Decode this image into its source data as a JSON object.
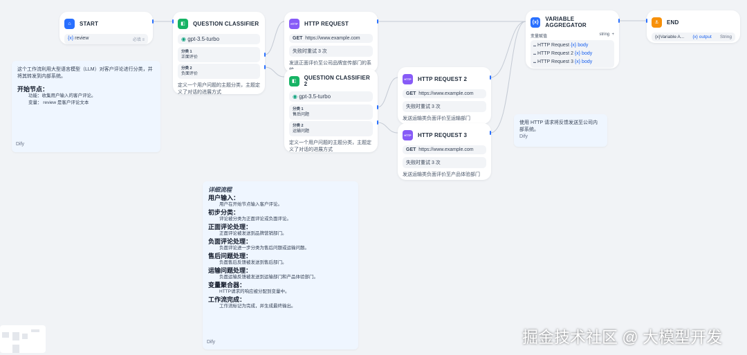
{
  "start": {
    "title": "START",
    "var": "review",
    "required": "必填"
  },
  "qc1": {
    "title": "QUESTION CLASSIFIER",
    "model": "gpt-3.5-turbo",
    "classes": [
      {
        "label": "分类 1",
        "value": "正面评价"
      },
      {
        "label": "分类 2",
        "value": "负面评价"
      }
    ],
    "desc": "定义一个用户问题的主题分类，主题定义了对话的进展方式"
  },
  "http1": {
    "title": "HTTP REQUEST",
    "method": "GET",
    "url": "https://www.example.com",
    "retry": "失败时重试 3 次",
    "desc": "发送正面评价至公司品牌宣传部门的系统"
  },
  "qc2": {
    "title": "QUESTION CLASSIFIER 2",
    "model": "gpt-3.5-turbo",
    "classes": [
      {
        "label": "分类 1",
        "value": "售后问题"
      },
      {
        "label": "分类 2",
        "value": "运输问题"
      }
    ],
    "desc": "定义一个用户问题的主题分类，主题定义了对话的进展方式"
  },
  "http2": {
    "title": "HTTP REQUEST 2",
    "method": "GET",
    "url": "https://www.example.com",
    "retry": "失败时重试 3 次",
    "desc": "发送运输类负面评价至运输部门"
  },
  "http3": {
    "title": "HTTP REQUEST 3",
    "method": "GET",
    "url": "https://www.example.com",
    "retry": "失败时重试 3 次",
    "desc": "发送运输类负面评价至产品体验部门"
  },
  "agg": {
    "title": "VARIABLE AGGREGATOR",
    "label": "变量赋值",
    "type": "string",
    "add": "+",
    "items": [
      {
        "node": "HTTP Request",
        "var": "body"
      },
      {
        "node": "HTTP Request 2",
        "var": "body"
      },
      {
        "node": "HTTP Request 3",
        "var": "body"
      }
    ]
  },
  "end": {
    "title": "END",
    "var": "Variable A...",
    "output": "output",
    "type": "String"
  },
  "note1": {
    "intro": "这个工作流利用大型语言模型（LLM）对客户评论进行分类，并将其转发到内部系统。",
    "heading": "开始节点：",
    "lines": [
      "功能：收集用户输入的客户评论。",
      "变量： review 是客户评论文本"
    ],
    "footer": "Dify"
  },
  "note2": {
    "text": "使用 HTTP 请求将反馈发送至公司内部系统。",
    "footer": "Dify"
  },
  "note3": {
    "title": "详细流程",
    "sections": [
      {
        "h": "用户输入：",
        "t": "用户在开始节点输入客户评论。"
      },
      {
        "h": "初步分类：",
        "t": "评论被分类为正面评论或负面评论。"
      },
      {
        "h": "正面评论处理：",
        "t": "正面评论被发送到品牌营销部门。"
      },
      {
        "h": "负面评论处理：",
        "t": "负面评论进一步分类为售后问题或运输问题。"
      },
      {
        "h": "售后问题处理：",
        "t": "负面售后反馈被发送到售后部门。"
      },
      {
        "h": "运输问题处理：",
        "t": "负面运输反馈被发送到运输部门和产品体验部门。"
      },
      {
        "h": "变量聚合器：",
        "t": "HTTP请求的响应被分配到变量中。"
      },
      {
        "h": "工作流完成：",
        "t": "工作流标记为完成，并生成最终输出。"
      }
    ],
    "footer": "Dify"
  },
  "watermark": "掘金技术社区 @ 大模型开发",
  "colors": {
    "start": "#2970ff",
    "classifier": "#16b364",
    "http": "#875bf7",
    "agg": "#2970ff",
    "end": "#f79009"
  }
}
